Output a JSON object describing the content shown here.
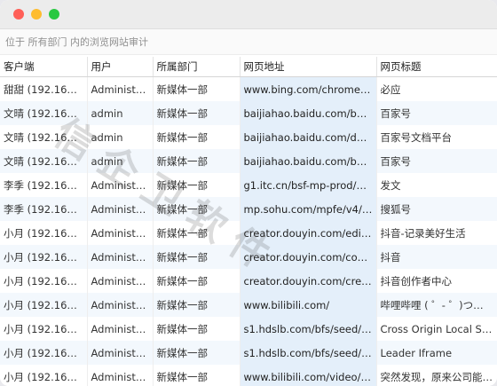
{
  "breadcrumb": "位于 所有部门 内的浏览网站审计",
  "columns": [
    "客户端",
    "用户",
    "所属部门",
    "网页地址",
    "网页标题"
  ],
  "rows": [
    [
      "甜甜 (192.168.1...",
      "Administra...",
      "新媒体一部",
      "www.bing.com/chrome/n...",
      "必应"
    ],
    [
      "文晴 (192.168.1...",
      "admin",
      "新媒体一部",
      "baijiahao.baidu.com/buil...",
      "百家号"
    ],
    [
      "文晴 (192.168.1...",
      "admin",
      "新媒体一部",
      "baijiahao.baidu.com/docs/...",
      "百家号文档平台"
    ],
    [
      "文晴 (192.168.1...",
      "admin",
      "新媒体一部",
      "baijiahao.baidu.com/buil...",
      "百家号"
    ],
    [
      "李季 (192.168.1...",
      "Administra...",
      "新媒体一部",
      "g1.itc.cn/bsf-mp-prod/m...",
      "发文"
    ],
    [
      "李季 (192.168.1...",
      "Administra...",
      "新媒体一部",
      "mp.sohu.com/mpfe/v4/c...",
      "搜狐号"
    ],
    [
      "小月 (192.168.1...",
      "Administra...",
      "新媒体一部",
      "creator.douyin.com/edit...",
      "抖音-记录美好生活"
    ],
    [
      "小月 (192.168.1...",
      "Administra...",
      "新媒体一部",
      "creator.douyin.com/cont...",
      "抖音"
    ],
    [
      "小月 (192.168.1...",
      "Administra...",
      "新媒体一部",
      "creator.douyin.com/creat...",
      "抖音创作者中心"
    ],
    [
      "小月 (192.168.1...",
      "Administra...",
      "新媒体一部",
      "www.bilibili.com/",
      "哔哩哔哩 ( ゜- ゜)つロ 干杯"
    ],
    [
      "小月 (192.168.1...",
      "Administra...",
      "新媒体一部",
      "s1.hdslb.com/bfs/seed/ji...",
      "Cross Origin Local Storage"
    ],
    [
      "小月 (192.168.1...",
      "Administra...",
      "新媒体一部",
      "s1.hdslb.com/bfs/seed/ji...",
      "Leader Iframe"
    ],
    [
      "小月 (192.168.1...",
      "Administra...",
      "新媒体一部",
      "www.bilibili.com/video/B...",
      "突然发现，原来公司能看到"
    ]
  ],
  "watermark": "信企卫软件"
}
